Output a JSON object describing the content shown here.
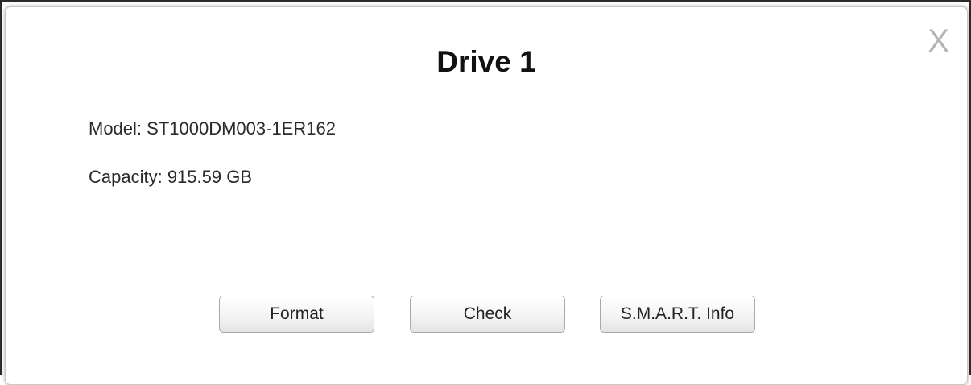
{
  "dialog": {
    "title": "Drive 1",
    "close_label": "X",
    "model_line": "Model: ST1000DM003-1ER162",
    "capacity_line": "Capacity: 915.59 GB"
  },
  "buttons": {
    "format_label": "Format",
    "check_label": "Check",
    "smart_label": "S.M.A.R.T. Info"
  }
}
